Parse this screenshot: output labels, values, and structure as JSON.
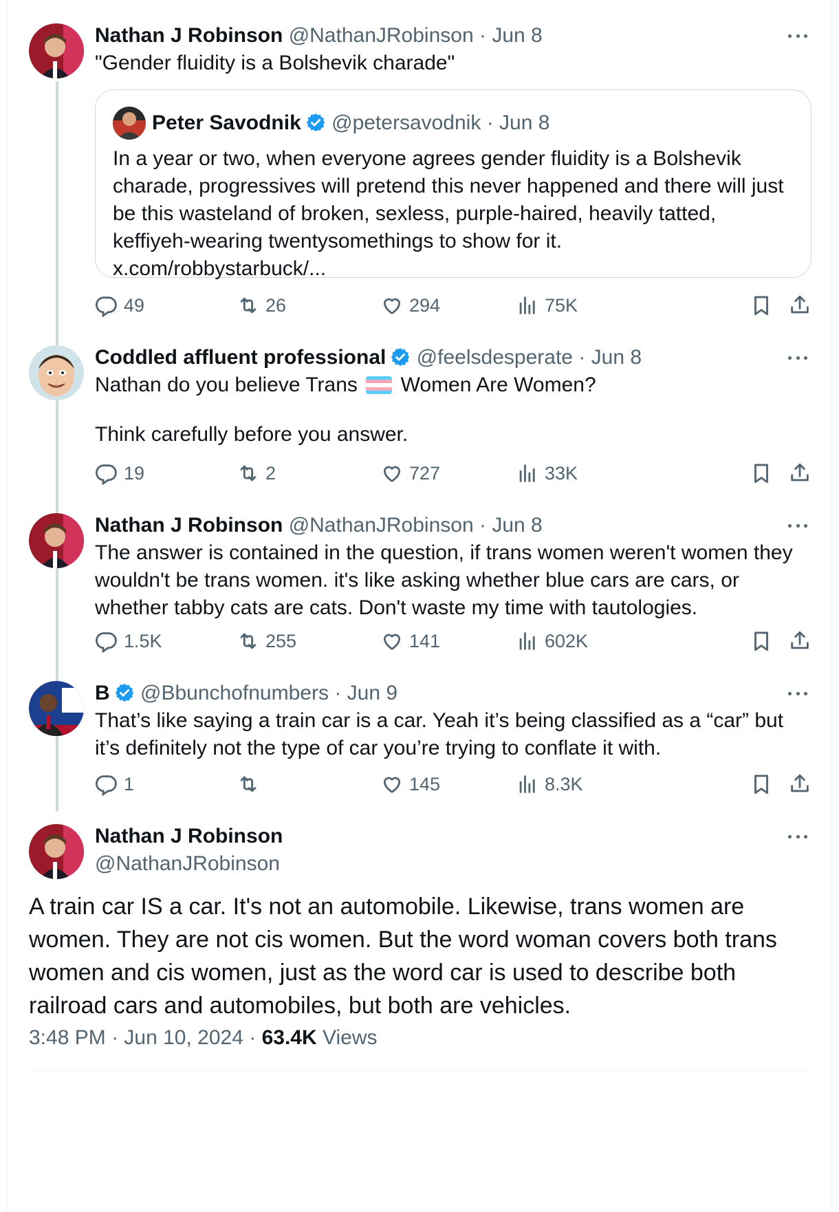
{
  "tweets": [
    {
      "name": "Nathan J Robinson",
      "handle": "@NathanJRobinson",
      "date": "Jun 8",
      "text": "\"Gender fluidity is a Bolshevik charade\"",
      "quote": {
        "name": "Peter Savodnik",
        "handle": "@petersavodnik",
        "date": "Jun 8",
        "text": "In a year or two, when everyone agrees gender fluidity is a Bolshevik charade, progressives will pretend this never happened and there will just be this wasteland of broken, sexless, purple-haired, heavily tatted, keffiyeh-wearing twentysomethings to show for it.",
        "link": "x.com/robbystarbuck/..."
      },
      "replies": "49",
      "reposts": "26",
      "likes": "294",
      "views": "75K"
    },
    {
      "name": "Coddled affluent professional",
      "handle": "@feelsdesperate",
      "date": "Jun 8",
      "text_a": "Nathan do you believe Trans",
      "text_b": "Women Are Women?",
      "text_c": "Think carefully before you answer.",
      "flag_icon": "transgender-flag-emoji",
      "replies": "19",
      "reposts": "2",
      "likes": "727",
      "views": "33K"
    },
    {
      "name": "Nathan J Robinson",
      "handle": "@NathanJRobinson",
      "date": "Jun 8",
      "text": "The answer is contained in the question, if trans women weren't women they wouldn't be trans women. it's like asking whether blue cars are cars, or whether tabby cats are cats. Don't waste my time with tautologies.",
      "replies": "1.5K",
      "reposts": "255",
      "likes": "141",
      "views": "602K"
    },
    {
      "name": "B",
      "handle": "@Bbunchofnumbers",
      "date": "Jun 9",
      "text": "That’s like saying a train car is a car. Yeah it’s being classified as a “car” but it’s definitely not the type of car you’re trying to conflate it with.",
      "replies": "1",
      "reposts": "",
      "likes": "145",
      "views": "8.3K"
    }
  ],
  "main": {
    "name": "Nathan J Robinson",
    "handle": "@NathanJRobinson",
    "text": "A train car IS a car. It's not an automobile. Likewise, trans women are women. They are not cis women. But the word woman covers both trans women and cis women, just as the word car is used to describe both railroad cars and automobiles, but both are vehicles.",
    "time": "3:48 PM",
    "date": "Jun 10, 2024",
    "views_count": "63.4K",
    "views_label": "Views"
  },
  "separator": "·",
  "colors": {
    "verified": "#1d9bf0",
    "muted": "#536471",
    "text": "#0f1419",
    "border": "#cfd9de"
  },
  "icons": [
    "reply-icon",
    "repost-icon",
    "like-icon",
    "views-icon",
    "bookmark-icon",
    "share-icon",
    "more-icon",
    "verified-badge-icon"
  ]
}
